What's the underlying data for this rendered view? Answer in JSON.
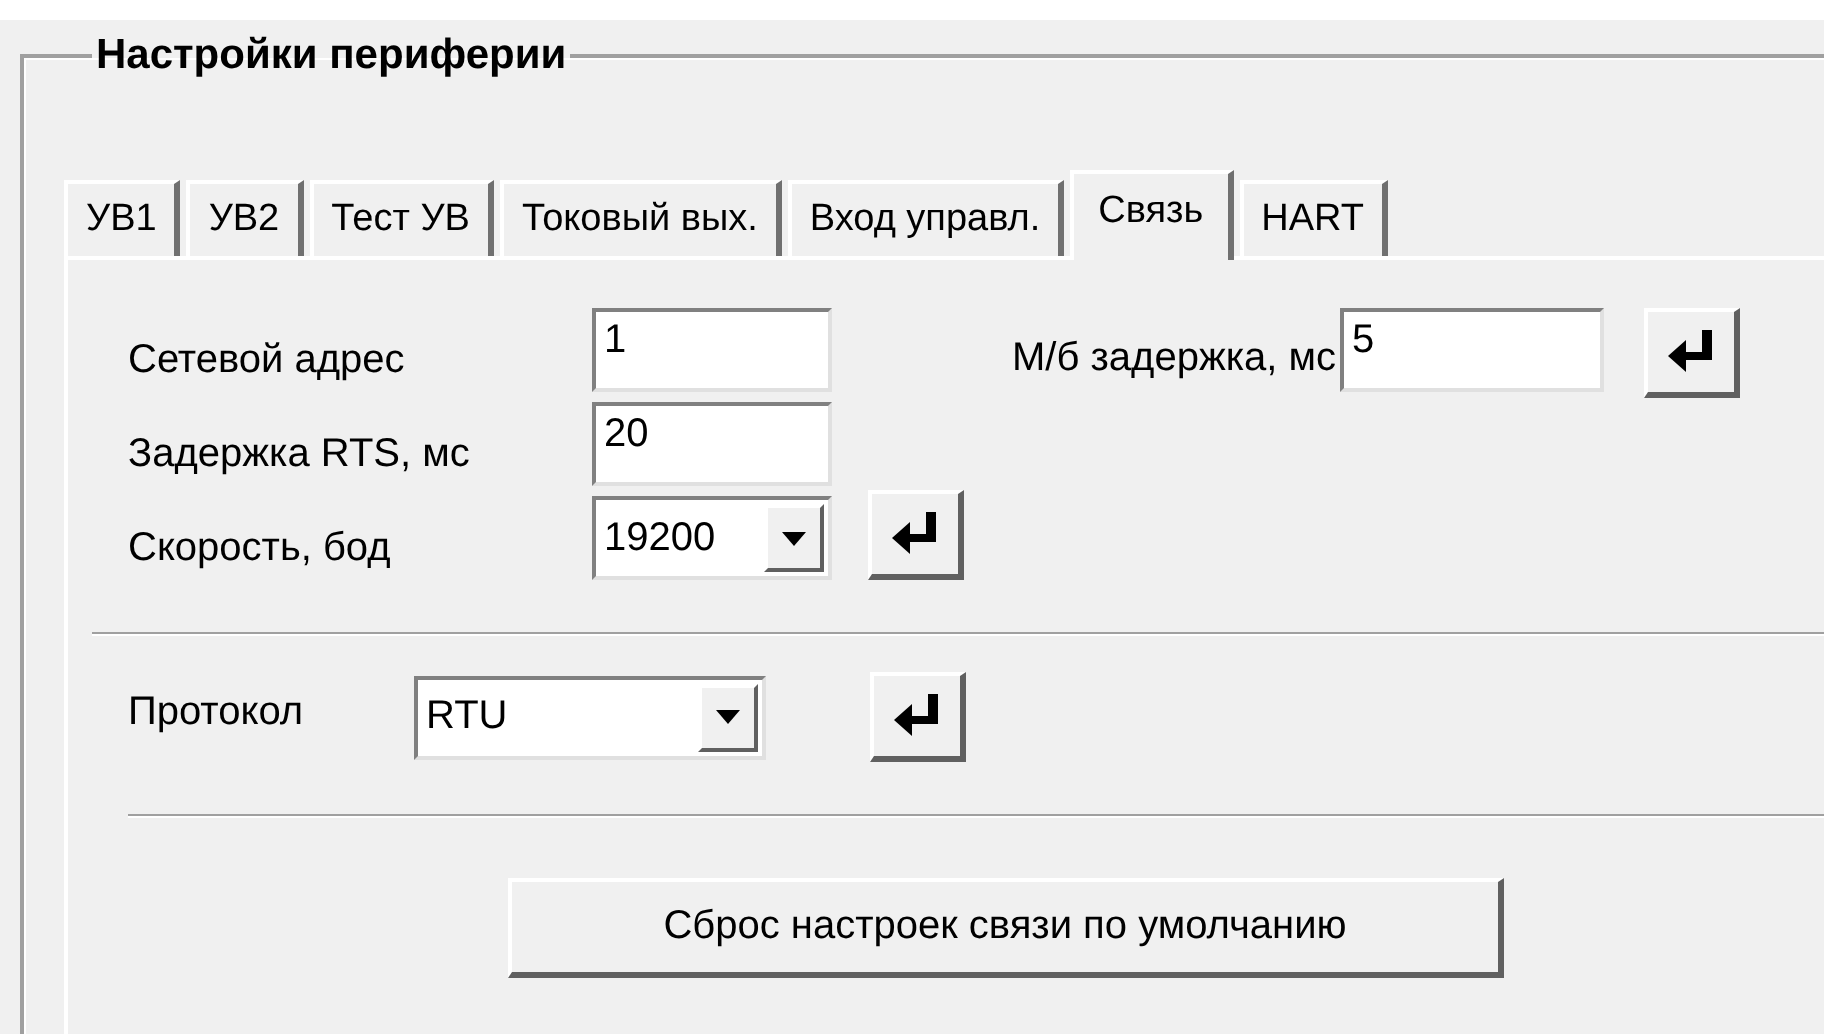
{
  "group": {
    "title": "Настройки периферии"
  },
  "tabs": [
    {
      "label": "УВ1",
      "selected": false
    },
    {
      "label": "УВ2",
      "selected": false
    },
    {
      "label": "Тест УВ",
      "selected": false
    },
    {
      "label": "Токовый вых.",
      "selected": false
    },
    {
      "label": "Вход управл.",
      "selected": false
    },
    {
      "label": "Связь",
      "selected": true
    },
    {
      "label": "HART",
      "selected": false
    }
  ],
  "settings": [
    {
      "kind": "input",
      "label": "Сетевой адрес",
      "value": "1",
      "apply": false
    },
    {
      "kind": "input",
      "label": "Задержка RTS, мс",
      "value": "20",
      "apply": false
    },
    {
      "kind": "combo",
      "label": "Скорость, бод",
      "value": "19200",
      "apply": true
    }
  ],
  "modbus_delay": {
    "label": "М/б задержка, мс",
    "value": "5",
    "apply": true
  },
  "protocol": {
    "label": "Протокол",
    "value": "RTU",
    "apply": true
  },
  "reset_button": "Сброс настроек связи по умолчанию"
}
